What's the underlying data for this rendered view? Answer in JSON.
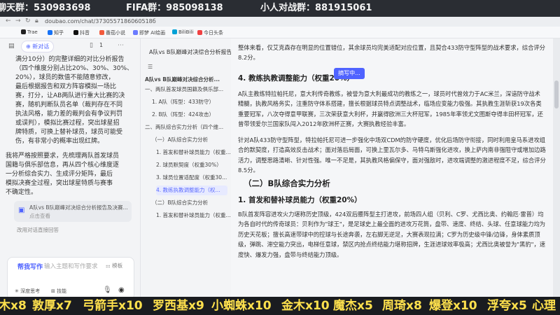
{
  "banner": {
    "items": [
      "聊天群：530983698",
      "FIFA群：985098138",
      "小人对战群：881915061"
    ]
  },
  "browser": {
    "url": "doubao.com/chat/3730557186060518б",
    "bookmarks": [
      "Trae",
      "知乎",
      "抖音",
      "番茄小说",
      "即梦 AI绘画",
      "BiliBili",
      "今日头条"
    ]
  },
  "chat": {
    "new_chat": "新对话",
    "page_count": "1",
    "message_lines": [
      "满分10分）的完整详细的对比分析报告",
      "（四个维度分别占比20%、30%、30%、",
      "20%），球员的数值不能随意修改，",
      "最后根据报告和双方阵容模拟一场比",
      "赛，打分，让AB两队进行重大比赛的决",
      "赛，随机判断队员名单（裁判存在不同",
      "执法风格，能力差的裁判会有争议判罚",
      "或误判），模拟比赛过程，突出球星招",
      "牌特质，可换上替补球员，球员可能受",
      "伤，有非常小的概率出现红牌。"
    ],
    "message2_lines": [
      "我将严格按照要求，先梳理两队首发球员",
      "国籍与俱乐部信息，再从四个核心维度逐",
      "一分析综合实力、生成评分矩阵，最后",
      "模拟决赛全过程，突出球星特质与赛事",
      "不确定性。"
    ],
    "file_name": "A队vs B队巅峰对决综合分析报告及决赛...",
    "file_sub": "点击查看",
    "regen_hint": "改用对话直接回答",
    "composer_title": "帮我写作",
    "composer_placeholder": "输入主题和写作要求",
    "composer_template": "模板",
    "deep_think": "深度思考",
    "skills": "技能"
  },
  "outline": {
    "doc_title": "A队vs B队巅峰对决综合分析报告及决赛模拟",
    "items": [
      {
        "text": "A队vs B队巅峰对决综合分析...",
        "active": false
      },
      {
        "text": "一、两队首发球员国籍及俱乐部...",
        "active": false
      },
      {
        "text": "1. A队（阵型：433防守）",
        "active": false
      },
      {
        "text": "2. B队（阵型：424攻击）",
        "active": false
      },
      {
        "text": "二、两队综合实力分析（四个维...",
        "active": false
      },
      {
        "text": "（一）A队综合实力分析",
        "active": false
      },
      {
        "text": "1. 首发和替补球员能力（权重...",
        "active": false
      },
      {
        "text": "2. 球员默契度（权重30%）",
        "active": false
      },
      {
        "text": "3. 球员位置适配度（权重30...",
        "active": false
      },
      {
        "text": "4. 教练执教调整能力（权...",
        "active": true
      },
      {
        "text": "（二）B队综合实力分析",
        "active": false
      },
      {
        "text": "1. 首发和替补球员能力（权重...",
        "active": false
      }
    ]
  },
  "doc": {
    "copy_badge": "摘写中...",
    "para0": "整体来看，仅艾克森存在明显的位置错位，其余球员均完美适配对应位置，且契合433防守型阵型的战术要求，综合评分8.2分。",
    "h_coach": "4. 教练执教调整能力（权重20%）",
    "para1": "A队主教练特拉帕托尼，意大利传奇教练，被誉为意大利最成功的教练之一，球员时代曾效力于AC米兰，深谙防守战术精髓，执教风格务实，注重防守体系搭建，擅长根据球员特点调整战术，临场应变能力极强。其执教生涯斩获19次各类重要冠军，八次夺得意甲联赛，三次荣获意大利杯，并赢得欧洲三大杯冠军，1985年率领尤文图斯夺得丰田杯冠军，还曾带领爱尔兰国家队闯入2012年欧洲杯正赛，大赛执教经验丰富。",
    "para2": "针对A队433防守型阵型，特拉帕托尼可进一步强化中场双CDM的防守硬度，优化后场防守衔接，同时利用皇马系进攻组合的默契度，打造高效反击战术；面对落后局面，可换上里瓦尔多、马特乌斯强化进攻，换上萨内南非强阻守或增加边路活力，调整思路清晰、针对性强。唯一不足是，其执教风格偏保守，面对强敌时，进攻端调整的激进程度不足，综合评分8.5分。",
    "h_team_b": "（二）B队综合实力分析",
    "h_b1": "1. 首发和替补球员能力（权重20%）",
    "para3": "B队首发阵容进攻火力堪称历史顶级，424双后腰阵型主打进攻，前场四人组（贝利、C罗、尤西比奥、约翰厄·雷普）均为各自时代的传奇球员：贝利作为\"球王\"，是足球史上最全面的进攻万花筒，盘带、速度、终结、头球、任意球能力均为历史天花板；擅长高速带球中的控球与长途奔袭，左右脚无逆足，大赛表现拉满；C罗为历史级中锋/边锋，身体素质顶级，弹跳、滞空能力突出，电梯任意球，禁区内抢点终结能力堪称招牌，生涯进球效率极高；尤西比奥被誉为\"黑豹\"，速度快、爆发力强，盘带与终结能力顶级。"
  },
  "gifts": {
    "items": [
      "木x8",
      "敦厚x7",
      "弓箭手x10",
      "罗西基x9",
      "小蜘蛛x10",
      "金木x10",
      "魔杰x5",
      "周琦x8",
      "爆登x10",
      "浮夸x5",
      "心理"
    ]
  }
}
